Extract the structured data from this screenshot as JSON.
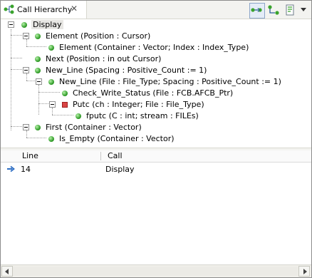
{
  "view": {
    "title": "Call Hierarchy",
    "close_glyph": "✕",
    "toolbar": [
      {
        "name": "show-callers-button",
        "icon": "callers-icon",
        "pressed": true
      },
      {
        "name": "show-callees-button",
        "icon": "callees-icon",
        "pressed": false
      },
      {
        "name": "history-button",
        "icon": "history-icon",
        "pressed": false
      },
      {
        "name": "view-menu-button",
        "icon": "chevron-down-icon",
        "pressed": false
      }
    ]
  },
  "tree": {
    "nodes": [
      {
        "label": "Display",
        "depth": 0,
        "expanded": true,
        "icon": "public",
        "selected": true
      },
      {
        "label": "Element (Position : Cursor)",
        "depth": 1,
        "expanded": true,
        "icon": "public"
      },
      {
        "label": "Element (Container : Vector; Index : Index_Type)",
        "depth": 2,
        "expanded": false,
        "icon": "public"
      },
      {
        "label": "Next (Position : in out Cursor)",
        "depth": 1,
        "expanded": false,
        "icon": "public"
      },
      {
        "label": "New_Line (Spacing : Positive_Count := 1)",
        "depth": 1,
        "expanded": true,
        "icon": "public"
      },
      {
        "label": "New_Line (File : File_Type; Spacing : Positive_Count := 1)",
        "depth": 2,
        "expanded": true,
        "icon": "public"
      },
      {
        "label": "Check_Write_Status (File : FCB.AFCB_Ptr)",
        "depth": 3,
        "expanded": false,
        "icon": "public"
      },
      {
        "label": "Putc (ch : Integer; File : File_Type)",
        "depth": 3,
        "expanded": true,
        "icon": "private"
      },
      {
        "label": "fputc (C : int; stream : FILEs)",
        "depth": 4,
        "expanded": false,
        "icon": "public"
      },
      {
        "label": "First (Container : Vector)",
        "depth": 1,
        "expanded": true,
        "icon": "public"
      },
      {
        "label": "Is_Empty (Container : Vector)",
        "depth": 2,
        "expanded": false,
        "icon": "public"
      }
    ]
  },
  "table": {
    "columns": [
      "Line",
      "Call"
    ],
    "rows": [
      {
        "icon": "arrow-right-icon",
        "line": "14",
        "call": "Display"
      }
    ]
  }
}
